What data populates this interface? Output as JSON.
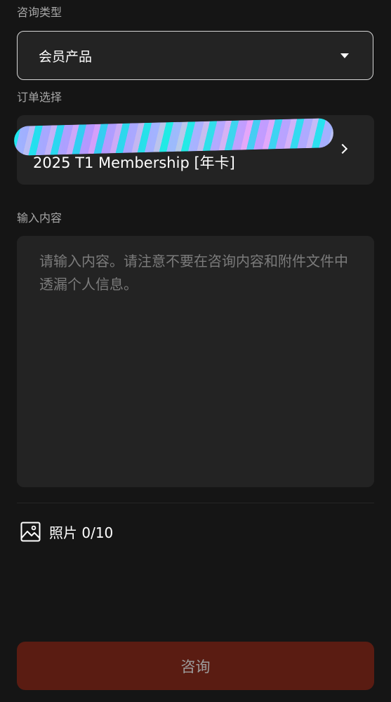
{
  "inquiry_type": {
    "label": "咨询类型",
    "selected_value": "会员产品",
    "dropdown_icon": "caret-down-icon"
  },
  "order_select": {
    "label": "订单选择",
    "order_name": "2025 T1 Membership [年卡]",
    "chevron_icon": "chevron-right-icon"
  },
  "content_input": {
    "label": "输入内容",
    "placeholder": "请输入内容。请注意不要在咨询内容和附件文件中透漏个人信息。",
    "value": ""
  },
  "photos": {
    "icon": "image-icon",
    "label": "照片 0/10"
  },
  "submit": {
    "label": "咨询",
    "background_color": "#5a1c12"
  }
}
